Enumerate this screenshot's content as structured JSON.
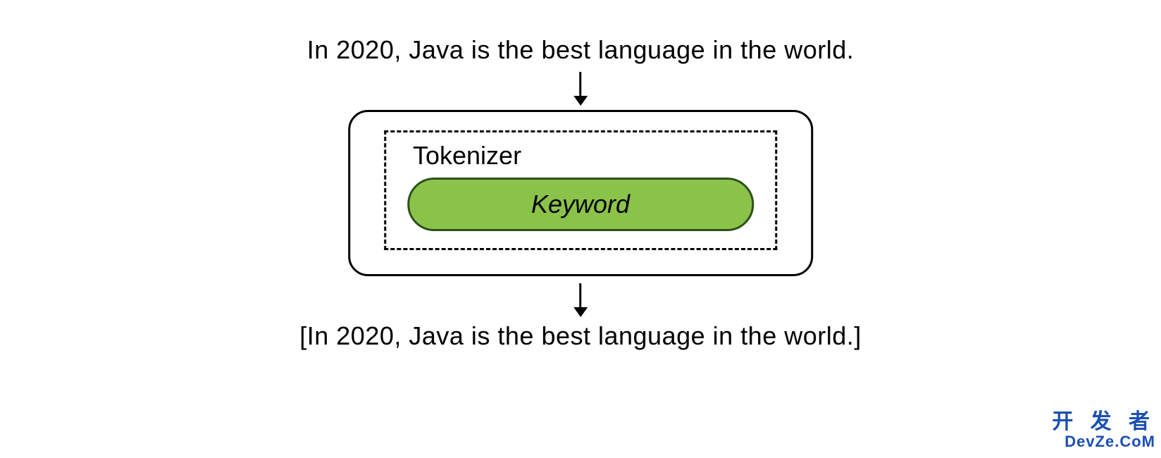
{
  "diagram": {
    "input_text": "In 2020, Java is the best language in the world.",
    "tokenizer_label": "Tokenizer",
    "keyword_label": "Keyword",
    "output_text": "[In 2020, Java is the best language in the world.]"
  },
  "watermark": {
    "line1": "开 发 者",
    "line2": "DevZe.CoM"
  },
  "colors": {
    "keyword_fill": "#8bc34a",
    "keyword_border": "#2d5016",
    "watermark_text": "#1a4fb3"
  }
}
